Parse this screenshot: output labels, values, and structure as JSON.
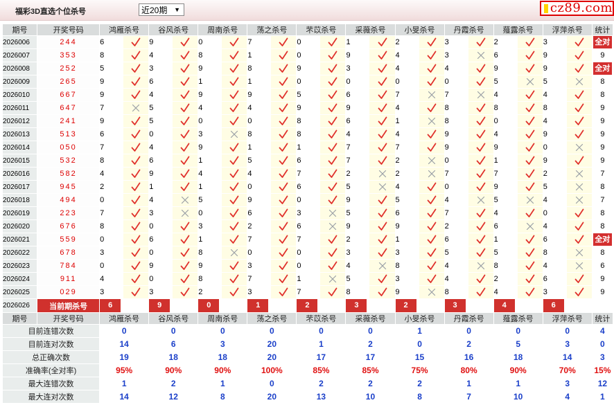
{
  "header": {
    "title": "福彩3D直选个位杀号",
    "period_select": "近20期",
    "logo": "cz89.com"
  },
  "columns": {
    "period": "期号",
    "draw": "开奖号码",
    "experts": [
      "鸿雁杀号",
      "谷风杀号",
      "周南杀号",
      "荡之杀号",
      "芣苡杀号",
      "采薇杀号",
      "小旻杀号",
      "丹霞杀号",
      "薤露杀号",
      "浮萍杀号"
    ],
    "stat": "统计"
  },
  "rows": [
    {
      "period": "2026006",
      "draw": "244",
      "vals": [
        6,
        9,
        0,
        7,
        0,
        1,
        2,
        3,
        2,
        3
      ],
      "ok": [
        1,
        1,
        1,
        1,
        1,
        1,
        1,
        1,
        1,
        1
      ],
      "stat": "全对"
    },
    {
      "period": "2026007",
      "draw": "353",
      "vals": [
        8,
        4,
        8,
        1,
        0,
        9,
        4,
        3,
        6,
        9
      ],
      "ok": [
        1,
        1,
        1,
        1,
        1,
        1,
        1,
        0,
        1,
        1
      ],
      "stat": "9"
    },
    {
      "period": "2026008",
      "draw": "252",
      "vals": [
        5,
        3,
        9,
        8,
        9,
        3,
        4,
        4,
        9,
        9
      ],
      "ok": [
        1,
        1,
        1,
        1,
        1,
        1,
        1,
        1,
        1,
        1
      ],
      "stat": "全对"
    },
    {
      "period": "2026009",
      "draw": "265",
      "vals": [
        9,
        6,
        1,
        1,
        0,
        0,
        0,
        0,
        5,
        5
      ],
      "ok": [
        1,
        1,
        1,
        1,
        1,
        1,
        1,
        1,
        0,
        0
      ],
      "stat": "8"
    },
    {
      "period": "2026010",
      "draw": "667",
      "vals": [
        9,
        4,
        9,
        9,
        5,
        6,
        7,
        7,
        4,
        4
      ],
      "ok": [
        1,
        1,
        1,
        1,
        1,
        1,
        0,
        0,
        1,
        1
      ],
      "stat": "8"
    },
    {
      "period": "2026011",
      "draw": "647",
      "vals": [
        7,
        5,
        4,
        4,
        9,
        9,
        4,
        8,
        8,
        8
      ],
      "ok": [
        0,
        1,
        1,
        1,
        1,
        1,
        1,
        1,
        1,
        1
      ],
      "stat": "9"
    },
    {
      "period": "2026012",
      "draw": "241",
      "vals": [
        9,
        5,
        0,
        0,
        8,
        6,
        1,
        8,
        0,
        4
      ],
      "ok": [
        1,
        1,
        1,
        1,
        1,
        1,
        0,
        1,
        1,
        1
      ],
      "stat": "9"
    },
    {
      "period": "2026013",
      "draw": "513",
      "vals": [
        6,
        0,
        3,
        8,
        8,
        4,
        4,
        9,
        4,
        9
      ],
      "ok": [
        1,
        1,
        0,
        1,
        1,
        1,
        1,
        1,
        1,
        1
      ],
      "stat": "9"
    },
    {
      "period": "2026014",
      "draw": "050",
      "vals": [
        7,
        4,
        9,
        1,
        1,
        7,
        7,
        9,
        9,
        0
      ],
      "ok": [
        1,
        1,
        1,
        1,
        1,
        1,
        1,
        1,
        1,
        0
      ],
      "stat": "9"
    },
    {
      "period": "2026015",
      "draw": "532",
      "vals": [
        8,
        6,
        1,
        5,
        6,
        7,
        2,
        0,
        1,
        9
      ],
      "ok": [
        1,
        1,
        1,
        1,
        1,
        1,
        0,
        1,
        1,
        1
      ],
      "stat": "9"
    },
    {
      "period": "2026016",
      "draw": "582",
      "vals": [
        4,
        9,
        4,
        4,
        7,
        2,
        2,
        7,
        7,
        2
      ],
      "ok": [
        1,
        1,
        1,
        1,
        1,
        0,
        0,
        1,
        1,
        0
      ],
      "stat": "7"
    },
    {
      "period": "2026017",
      "draw": "945",
      "vals": [
        2,
        1,
        1,
        0,
        6,
        5,
        4,
        0,
        9,
        5
      ],
      "ok": [
        1,
        1,
        1,
        1,
        1,
        0,
        1,
        1,
        1,
        0
      ],
      "stat": "8"
    },
    {
      "period": "2026018",
      "draw": "494",
      "vals": [
        0,
        4,
        5,
        9,
        0,
        9,
        5,
        4,
        5,
        4
      ],
      "ok": [
        1,
        0,
        1,
        1,
        1,
        1,
        1,
        0,
        0,
        0
      ],
      "stat": "7"
    },
    {
      "period": "2026019",
      "draw": "223",
      "vals": [
        7,
        3,
        0,
        6,
        3,
        5,
        6,
        7,
        4,
        0
      ],
      "ok": [
        1,
        0,
        1,
        1,
        0,
        1,
        1,
        1,
        1,
        1
      ],
      "stat": "8"
    },
    {
      "period": "2026020",
      "draw": "676",
      "vals": [
        8,
        0,
        3,
        2,
        6,
        9,
        9,
        2,
        6,
        4
      ],
      "ok": [
        1,
        1,
        1,
        1,
        0,
        1,
        1,
        1,
        0,
        1
      ],
      "stat": "8"
    },
    {
      "period": "2026021",
      "draw": "559",
      "vals": [
        0,
        6,
        1,
        7,
        7,
        2,
        1,
        6,
        1,
        6
      ],
      "ok": [
        1,
        1,
        1,
        1,
        1,
        1,
        1,
        1,
        1,
        1
      ],
      "stat": "全对"
    },
    {
      "period": "2026022",
      "draw": "678",
      "vals": [
        3,
        0,
        8,
        0,
        0,
        3,
        3,
        5,
        5,
        8
      ],
      "ok": [
        1,
        1,
        0,
        1,
        1,
        1,
        1,
        1,
        1,
        0
      ],
      "stat": "8"
    },
    {
      "period": "2026023",
      "draw": "784",
      "vals": [
        0,
        9,
        9,
        3,
        0,
        4,
        8,
        4,
        8,
        4
      ],
      "ok": [
        1,
        1,
        1,
        1,
        1,
        0,
        1,
        0,
        1,
        0
      ],
      "stat": "6"
    },
    {
      "period": "2026024",
      "draw": "911",
      "vals": [
        4,
        0,
        8,
        7,
        1,
        5,
        3,
        4,
        2,
        6
      ],
      "ok": [
        1,
        1,
        1,
        1,
        0,
        1,
        1,
        1,
        1,
        1
      ],
      "stat": "9"
    },
    {
      "period": "2026025",
      "draw": "029",
      "vals": [
        3,
        3,
        2,
        3,
        7,
        8,
        9,
        8,
        4,
        3
      ],
      "ok": [
        1,
        1,
        1,
        1,
        1,
        1,
        0,
        1,
        1,
        1
      ],
      "stat": "9"
    }
  ],
  "current": {
    "period": "2026026",
    "label": "当前期杀号",
    "vals": [
      "6",
      "9",
      "0",
      "1",
      "2",
      "3",
      "2",
      "3",
      "4",
      "6"
    ]
  },
  "stats": [
    {
      "label": "目前连错次数",
      "vals": [
        "0",
        "0",
        "0",
        "0",
        "0",
        "0",
        "1",
        "0",
        "0",
        "0"
      ],
      "stat": "4"
    },
    {
      "label": "目前连对次数",
      "vals": [
        "14",
        "6",
        "3",
        "20",
        "1",
        "2",
        "0",
        "2",
        "5",
        "3"
      ],
      "stat": "0"
    },
    {
      "label": "总正确次数",
      "vals": [
        "19",
        "18",
        "18",
        "20",
        "17",
        "17",
        "15",
        "16",
        "18",
        "14"
      ],
      "stat": "3"
    },
    {
      "label": "准确率(全对率)",
      "vals": [
        "95%",
        "90%",
        "90%",
        "100%",
        "85%",
        "85%",
        "75%",
        "80%",
        "90%",
        "70%"
      ],
      "stat": "15%"
    },
    {
      "label": "最大连错次数",
      "vals": [
        "1",
        "2",
        "1",
        "0",
        "2",
        "2",
        "2",
        "1",
        "1",
        "3"
      ],
      "stat": "12"
    },
    {
      "label": "最大连对次数",
      "vals": [
        "14",
        "12",
        "8",
        "20",
        "13",
        "10",
        "8",
        "7",
        "10",
        "4"
      ],
      "stat": "1"
    }
  ],
  "colors": {
    "check": "#e0312c",
    "cross": "#9aa0a6",
    "accent": "#d0312d",
    "blue": "#1a3fc9"
  }
}
